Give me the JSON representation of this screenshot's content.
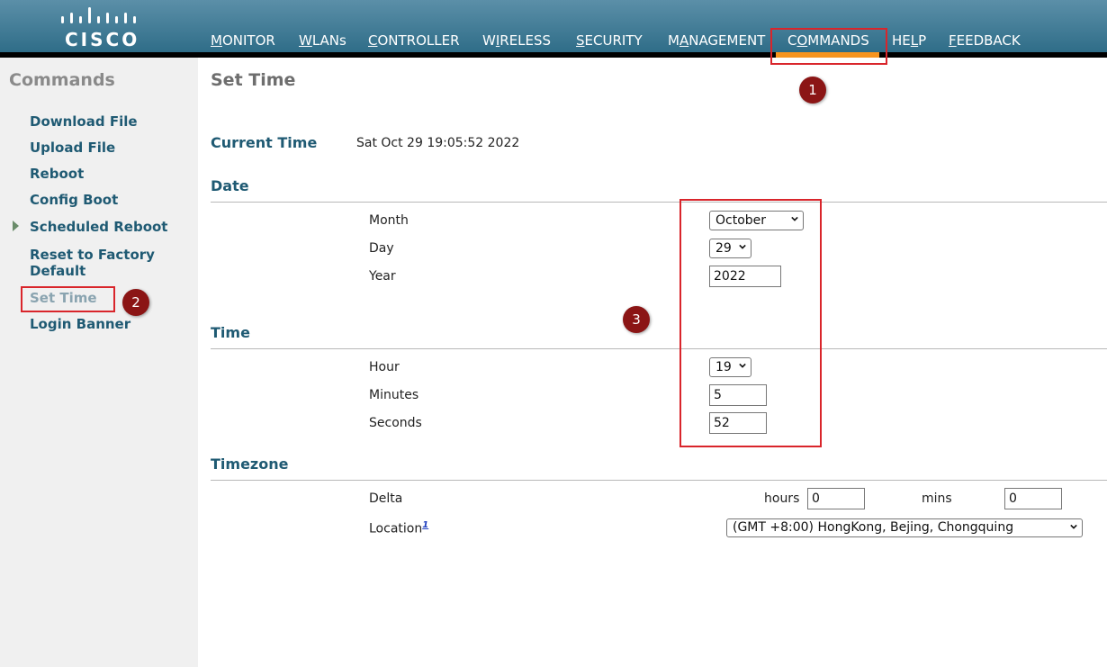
{
  "brand": {
    "logo_text": "CISCO"
  },
  "nav": {
    "items": [
      {
        "pre": "",
        "u": "M",
        "post": "ONITOR"
      },
      {
        "pre": "",
        "u": "W",
        "post": "LANs"
      },
      {
        "pre": "",
        "u": "C",
        "post": "ONTROLLER"
      },
      {
        "pre": "W",
        "u": "I",
        "post": "RELESS"
      },
      {
        "pre": "",
        "u": "S",
        "post": "ECURITY"
      },
      {
        "pre": "M",
        "u": "A",
        "post": "NAGEMENT"
      },
      {
        "pre": "C",
        "u": "O",
        "post": "MMANDS"
      },
      {
        "pre": "HE",
        "u": "L",
        "post": "P"
      },
      {
        "pre": "",
        "u": "F",
        "post": "EEDBACK"
      }
    ],
    "active": "COMMANDS"
  },
  "sidebar": {
    "title": "Commands",
    "items": [
      {
        "label": "Download File"
      },
      {
        "label": "Upload File"
      },
      {
        "label": "Reboot"
      },
      {
        "label": "Config Boot"
      },
      {
        "label": "Scheduled Reboot"
      },
      {
        "label": "Reset to Factory Default"
      },
      {
        "label": "Set Time"
      },
      {
        "label": "Login Banner"
      }
    ]
  },
  "main": {
    "title": "Set Time",
    "current_time_label": "Current Time",
    "current_time_value": "Sat Oct 29 19:05:52 2022",
    "date": {
      "heading": "Date",
      "month_label": "Month",
      "month_value": "October",
      "day_label": "Day",
      "day_value": "29",
      "year_label": "Year",
      "year_value": "2022"
    },
    "time": {
      "heading": "Time",
      "hour_label": "Hour",
      "hour_value": "19",
      "minutes_label": "Minutes",
      "minutes_value": "5",
      "seconds_label": "Seconds",
      "seconds_value": "52"
    },
    "timezone": {
      "heading": "Timezone",
      "delta_label": "Delta",
      "hours_label": "hours",
      "hours_value": "0",
      "mins_label": "mins",
      "mins_value": "0",
      "location_label": "Location",
      "location_footnote": "1",
      "location_value": "(GMT +8:00) HongKong, Bejing, Chongquing"
    }
  },
  "annotations": {
    "badge1": "1",
    "badge2": "2",
    "badge3": "3"
  },
  "colors": {
    "accent": "#f7941e",
    "header": "#2f6d88",
    "annotation": "#d9252b",
    "badge": "#8b1515"
  }
}
